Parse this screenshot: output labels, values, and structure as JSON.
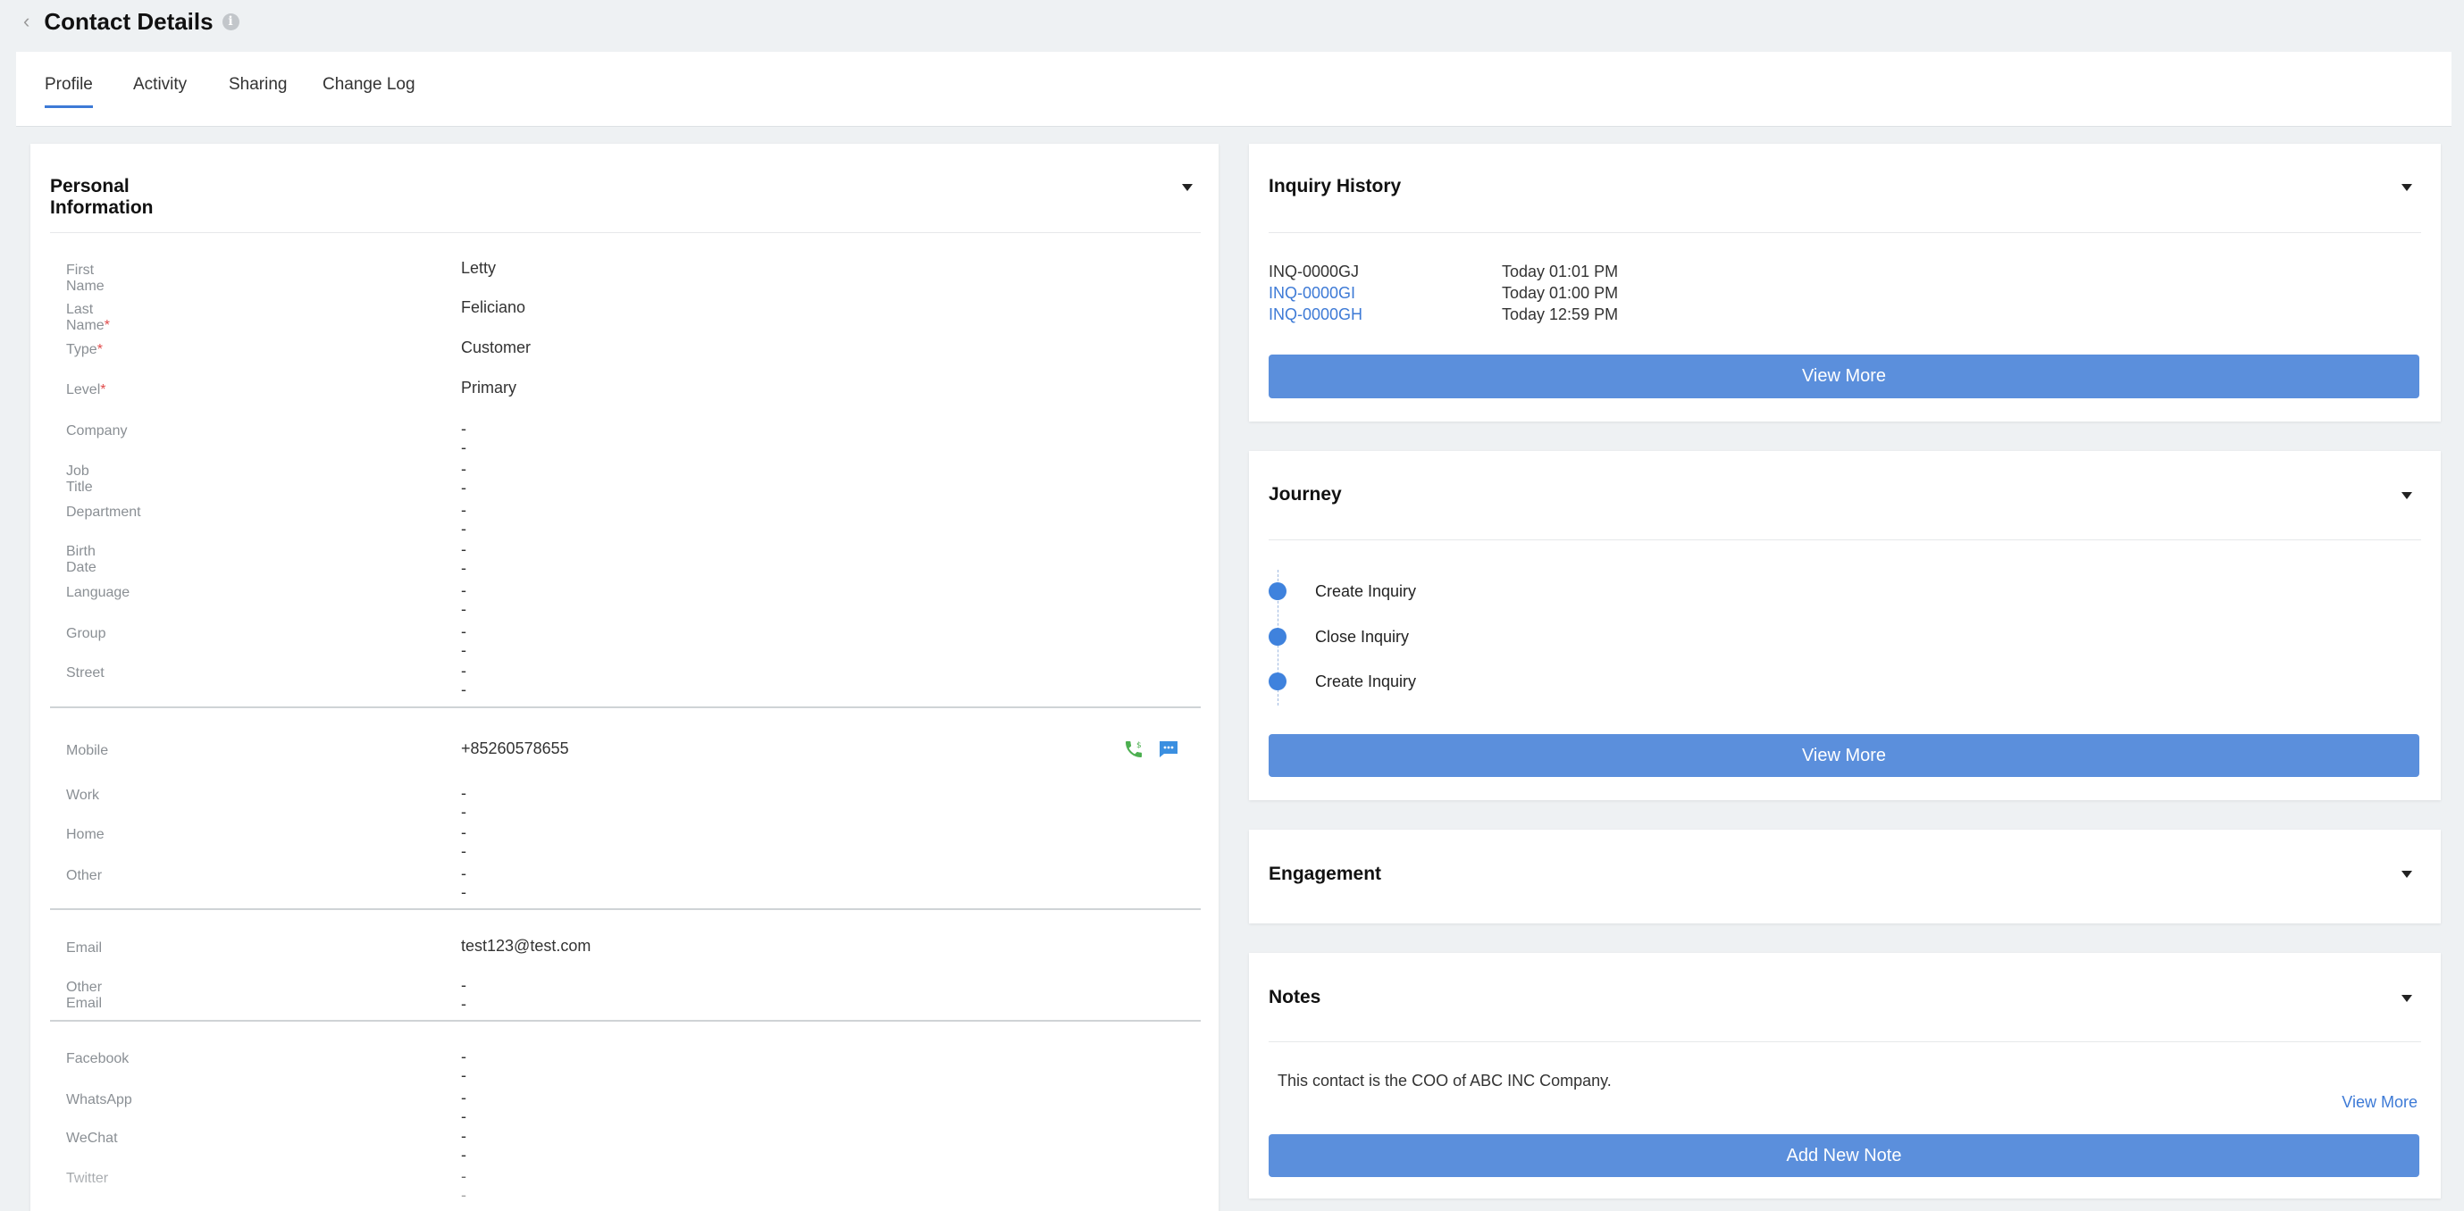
{
  "header": {
    "title": "Contact Details",
    "info_glyph": "i"
  },
  "tabs": [
    {
      "label": "Profile",
      "active": true
    },
    {
      "label": "Activity",
      "active": false
    },
    {
      "label": "Sharing",
      "active": false
    },
    {
      "label": "Change Log",
      "active": false
    }
  ],
  "personal": {
    "title": "Personal Information",
    "fields": [
      {
        "label": "First Name",
        "required": false,
        "value": "Letty"
      },
      {
        "label": "Last Name",
        "required": true,
        "value": "Feliciano"
      },
      {
        "label": "Type",
        "required": true,
        "value": "Customer"
      },
      {
        "label": "Level",
        "required": true,
        "value": "Primary"
      },
      {
        "label": "Company",
        "required": false,
        "value": "--"
      },
      {
        "label": "Job Title",
        "required": false,
        "value": "--"
      },
      {
        "label": "Department",
        "required": false,
        "value": "--"
      },
      {
        "label": "Birth Date",
        "required": false,
        "value": "--"
      },
      {
        "label": "Language",
        "required": false,
        "value": "--"
      },
      {
        "label": "Group",
        "required": false,
        "value": "--"
      },
      {
        "label": "Street",
        "required": false,
        "value": "--"
      },
      {
        "label": "Mobile",
        "required": false,
        "value": "+85260578655"
      },
      {
        "label": "Work",
        "required": false,
        "value": "--"
      },
      {
        "label": "Home",
        "required": false,
        "value": "--"
      },
      {
        "label": "Other",
        "required": false,
        "value": "--"
      },
      {
        "label": "Email",
        "required": false,
        "value": "test123@test.com"
      },
      {
        "label": "Other Email",
        "required": false,
        "value": "--"
      },
      {
        "label": "Facebook",
        "required": false,
        "value": "--"
      },
      {
        "label": "WhatsApp",
        "required": false,
        "value": "--"
      },
      {
        "label": "WeChat",
        "required": false,
        "value": "--"
      },
      {
        "label": "Twitter",
        "required": false,
        "value": "--"
      }
    ],
    "required_mark": "*"
  },
  "inquiry": {
    "title": "Inquiry History",
    "items": [
      {
        "id": "INQ-0000GJ",
        "time": "Today 01:01 PM",
        "link": false
      },
      {
        "id": "INQ-0000GI",
        "time": "Today 01:00 PM",
        "link": true
      },
      {
        "id": "INQ-0000GH",
        "time": "Today 12:59 PM",
        "link": true
      }
    ],
    "view_more": "View More"
  },
  "journey": {
    "title": "Journey",
    "steps": [
      "Create Inquiry",
      "Close Inquiry",
      "Create Inquiry"
    ],
    "view_more": "View More"
  },
  "engagement": {
    "title": "Engagement"
  },
  "notes": {
    "title": "Notes",
    "text": "This contact is the COO of ABC INC Company.",
    "view_more": "View More",
    "add_button": "Add New Note"
  },
  "colors": {
    "accent": "#5b8fdc",
    "link": "#3d7ad6",
    "call_icon": "#4caf50",
    "sms_icon": "#3b8fe0",
    "required": "#e14b4b"
  }
}
